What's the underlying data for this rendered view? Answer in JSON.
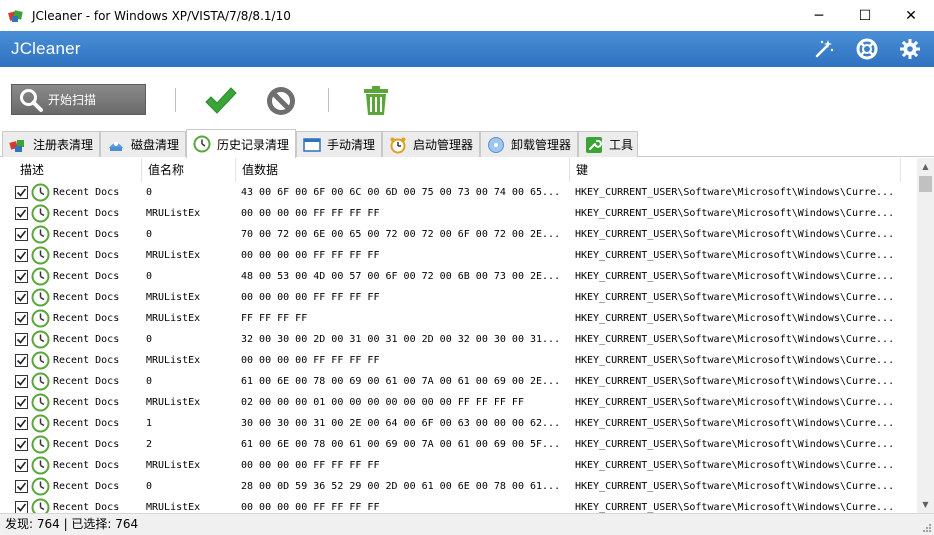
{
  "window": {
    "title": "JCleaner - for Windows XP/VISTA/7/8/8.1/10",
    "minimize_glyph": "─",
    "maximize_glyph": "☐",
    "close_glyph": "✕"
  },
  "header": {
    "brand": "JCleaner",
    "icons": [
      "magic-wand-icon",
      "lifebuoy-icon",
      "gear-icon"
    ]
  },
  "toolbar": {
    "scan_label": "开始扫描",
    "icons": [
      "search-icon",
      "checkmark-icon",
      "cancel-icon",
      "trash-icon"
    ]
  },
  "tabs": [
    {
      "label": "注册表清理",
      "icon": "registry-icon"
    },
    {
      "label": "磁盘清理",
      "icon": "disk-icon"
    },
    {
      "label": "历史记录清理",
      "icon": "history-clock-icon",
      "active": true
    },
    {
      "label": "手动清理",
      "icon": "window-icon"
    },
    {
      "label": "启动管理器",
      "icon": "alarm-clock-icon"
    },
    {
      "label": "卸载管理器",
      "icon": "cd-icon"
    },
    {
      "label": "工具",
      "icon": "wrench-icon"
    }
  ],
  "table": {
    "columns": [
      "描述",
      "值名称",
      "值数据",
      "键"
    ],
    "rows": [
      {
        "desc": "Recent Docs",
        "name": "0",
        "data": "43 00 6F 00 6F 00 6C 00 6D 00 75 00 73 00 74 00 65...",
        "key": "HKEY_CURRENT_USER\\Software\\Microsoft\\Windows\\Curre..."
      },
      {
        "desc": "Recent Docs",
        "name": "MRUListEx",
        "data": "00 00 00 00 FF FF FF FF",
        "key": "HKEY_CURRENT_USER\\Software\\Microsoft\\Windows\\Curre..."
      },
      {
        "desc": "Recent Docs",
        "name": "0",
        "data": "70 00 72 00 6E 00 65 00 72 00 72 00 6F 00 72 00 2E...",
        "key": "HKEY_CURRENT_USER\\Software\\Microsoft\\Windows\\Curre..."
      },
      {
        "desc": "Recent Docs",
        "name": "MRUListEx",
        "data": "00 00 00 00 FF FF FF FF",
        "key": "HKEY_CURRENT_USER\\Software\\Microsoft\\Windows\\Curre..."
      },
      {
        "desc": "Recent Docs",
        "name": "0",
        "data": "48 00 53 00 4D 00 57 00 6F 00 72 00 6B 00 73 00 2E...",
        "key": "HKEY_CURRENT_USER\\Software\\Microsoft\\Windows\\Curre..."
      },
      {
        "desc": "Recent Docs",
        "name": "MRUListEx",
        "data": "00 00 00 00 FF FF FF FF",
        "key": "HKEY_CURRENT_USER\\Software\\Microsoft\\Windows\\Curre..."
      },
      {
        "desc": "Recent Docs",
        "name": "MRUListEx",
        "data": "FF FF FF FF",
        "key": "HKEY_CURRENT_USER\\Software\\Microsoft\\Windows\\Curre..."
      },
      {
        "desc": "Recent Docs",
        "name": "0",
        "data": "32 00 30 00 2D 00 31 00 31 00 2D 00 32 00 30 00 31...",
        "key": "HKEY_CURRENT_USER\\Software\\Microsoft\\Windows\\Curre..."
      },
      {
        "desc": "Recent Docs",
        "name": "MRUListEx",
        "data": "00 00 00 00 FF FF FF FF",
        "key": "HKEY_CURRENT_USER\\Software\\Microsoft\\Windows\\Curre..."
      },
      {
        "desc": "Recent Docs",
        "name": "0",
        "data": "61 00 6E 00 78 00 69 00 61 00 7A 00 61 00 69 00 2E...",
        "key": "HKEY_CURRENT_USER\\Software\\Microsoft\\Windows\\Curre..."
      },
      {
        "desc": "Recent Docs",
        "name": "MRUListEx",
        "data": "02 00 00 00 01 00 00 00 00 00 00 00 FF FF FF FF",
        "key": "HKEY_CURRENT_USER\\Software\\Microsoft\\Windows\\Curre..."
      },
      {
        "desc": "Recent Docs",
        "name": "1",
        "data": "30 00 30 00 31 00 2E 00 64 00 6F 00 63 00 00 00 62...",
        "key": "HKEY_CURRENT_USER\\Software\\Microsoft\\Windows\\Curre..."
      },
      {
        "desc": "Recent Docs",
        "name": "2",
        "data": "61 00 6E 00 78 00 61 00 69 00 7A 00 61 00 69 00 5F...",
        "key": "HKEY_CURRENT_USER\\Software\\Microsoft\\Windows\\Curre..."
      },
      {
        "desc": "Recent Docs",
        "name": "MRUListEx",
        "data": "00 00 00 00 FF FF FF FF",
        "key": "HKEY_CURRENT_USER\\Software\\Microsoft\\Windows\\Curre..."
      },
      {
        "desc": "Recent Docs",
        "name": "0",
        "data": "28 00 0D 59 36 52 29 00 2D 00 61 00 6E 00 78 00 61...",
        "key": "HKEY_CURRENT_USER\\Software\\Microsoft\\Windows\\Curre..."
      },
      {
        "desc": "Recent Docs",
        "name": "MRUListEx",
        "data": "00 00 00 00 FF FF FF FF",
        "key": "HKEY_CURRENT_USER\\Software\\Microsoft\\Windows\\Curre..."
      }
    ]
  },
  "status": {
    "text": "发现: 764 | 已选择: 764"
  },
  "colors": {
    "header_blue": "#3a80cc",
    "check_green": "#3aa536",
    "trash_green": "#5aa63a"
  }
}
